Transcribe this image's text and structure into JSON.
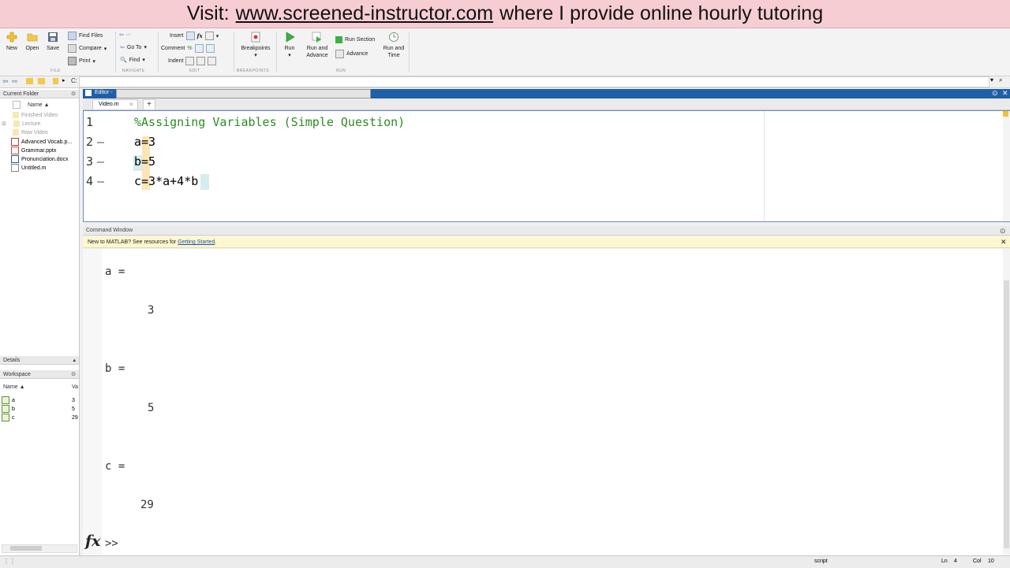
{
  "banner": {
    "prefix": "Visit:",
    "url": "www.screened-instructor.com",
    "suffix": "where I provide online hourly tutoring"
  },
  "ribbon": {
    "file": {
      "new": "New",
      "open": "Open",
      "save": "Save",
      "find_files": "Find Files",
      "compare": "Compare",
      "print": "Print",
      "group": "FILE"
    },
    "navigate": {
      "go_to": "Go To",
      "find": "Find",
      "group": "NAVIGATE"
    },
    "edit": {
      "insert": "Insert",
      "comment": "Comment",
      "indent": "Indent",
      "group": "EDIT",
      "fx": "fx",
      "pct": "%"
    },
    "breakpoints": {
      "label": "Breakpoints",
      "group": "BREAKPOINTS"
    },
    "run": {
      "run": "Run",
      "run_and_advance": "Run and Advance",
      "run_section": "Run Section",
      "advance": "Advance",
      "run_and_time": "Run and Time",
      "group": "RUN"
    }
  },
  "address": {
    "path": "C:"
  },
  "current_folder": {
    "title": "Current Folder",
    "column": "Name ▲",
    "items": [
      "Finished Video",
      "Lecture",
      "Raw Video",
      "Advanced Vocab.p...",
      "Grammar.pptx",
      "Pronunciation.docx",
      "Untitled.m"
    ]
  },
  "details": {
    "title": "Details"
  },
  "workspace": {
    "title": "Workspace",
    "col_name": "Name ▲",
    "col_value": "Va",
    "vars": [
      {
        "name": "a",
        "value": "3"
      },
      {
        "name": "b",
        "value": "5"
      },
      {
        "name": "c",
        "value": "29"
      }
    ]
  },
  "editor": {
    "title": "Editor -",
    "tab": "Video.m",
    "add_tab": "+",
    "lines": [
      {
        "num": "1",
        "dash": "",
        "code": "%Assigning Variables (Simple Question)"
      },
      {
        "num": "2",
        "dash": "—",
        "code": "a=3"
      },
      {
        "num": "3",
        "dash": "—",
        "code": "b=5"
      },
      {
        "num": "4",
        "dash": "—",
        "code": "c=3*a+4*b"
      }
    ]
  },
  "command_window": {
    "title": "Command Window",
    "note_prefix": "New to MATLAB? See resources for ",
    "note_link": "Getting Started",
    "note_suffix": ".",
    "outputs": [
      {
        "label": "a =",
        "value": "3"
      },
      {
        "label": "b =",
        "value": "5"
      },
      {
        "label": "c =",
        "value": "29"
      }
    ],
    "prompt_fx": "fx",
    "prompt": ">>"
  },
  "status": {
    "mode": "script",
    "ln_label": "Ln",
    "ln": "4",
    "col_label": "Col",
    "col": "10"
  },
  "colors": {
    "accent": "#1f5fa8",
    "comment": "#2e8b22",
    "banner": "#f6cdd3"
  }
}
